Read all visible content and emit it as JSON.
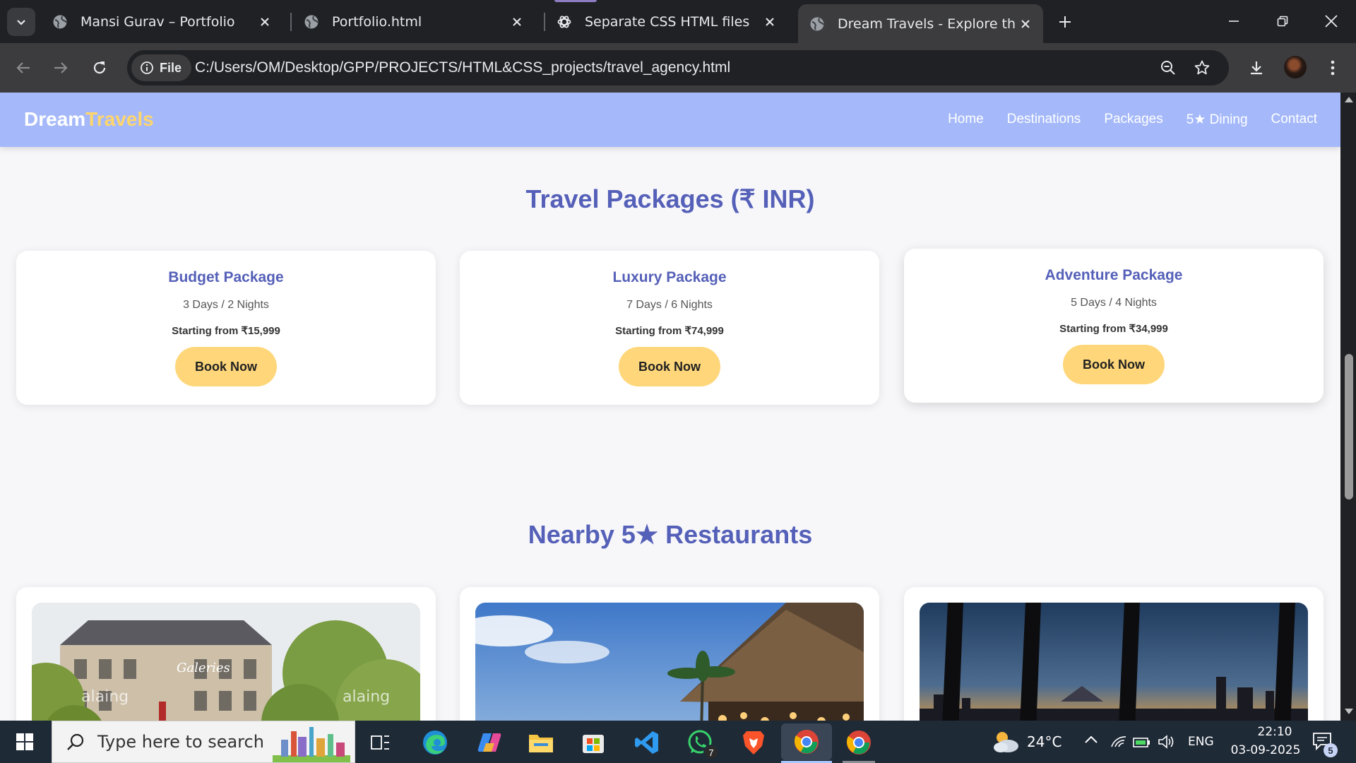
{
  "browser": {
    "tabs": [
      {
        "title": "Mansi Gurav – Portfolio",
        "active": false
      },
      {
        "title": "Portfolio.html",
        "active": false
      },
      {
        "title": "Separate CSS HTML files",
        "active": false
      },
      {
        "title": "Dream Travels - Explore the Wo",
        "active": true
      }
    ],
    "url_chip": "File",
    "url": "C:/Users/OM/Desktop/GPP/PROJECTS/HTML&CSS_projects/travel_agency.html"
  },
  "site": {
    "logo_part1": "Dream",
    "logo_part2": "Travels",
    "nav": [
      "Home",
      "Destinations",
      "Packages",
      "5★ Dining",
      "Contact"
    ],
    "packages_title": "Travel Packages (₹ INR)",
    "packages": [
      {
        "name": "Budget Package",
        "duration": "3 Days / 2 Nights",
        "price": "Starting from ₹15,999",
        "button": "Book Now"
      },
      {
        "name": "Luxury Package",
        "duration": "7 Days / 6 Nights",
        "price": "Starting from ₹74,999",
        "button": "Book Now"
      },
      {
        "name": "Adventure Package",
        "duration": "5 Days / 4 Nights",
        "price": "Starting from ₹34,999",
        "button": "Book Now"
      }
    ],
    "restaurants_title": "Nearby 5★ Restaurants"
  },
  "taskbar": {
    "search_placeholder": "Type here to search",
    "weather": "24°C",
    "language": "ENG",
    "time": "22:10",
    "date": "03-09-2025",
    "whatsapp_badge": "7",
    "notification_badge": "5"
  },
  "colors": {
    "nav_bg": "#a5b9fa",
    "accent_title": "#5560b8",
    "logo_highlight": "#ffd66b",
    "button_bg": "#ffd77a",
    "page_bg": "#f7f7fa"
  }
}
